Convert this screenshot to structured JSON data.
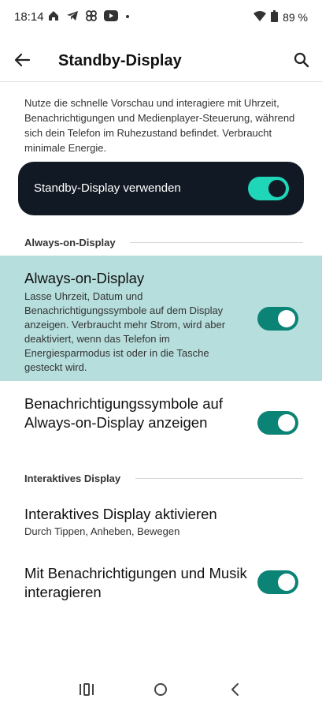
{
  "status_bar": {
    "time": "18:14",
    "battery": "89 %",
    "icons": [
      "home-icon",
      "telegram-icon",
      "chat-icon",
      "youtube-icon",
      "dot-icon",
      "wifi-icon",
      "battery-icon"
    ]
  },
  "header": {
    "title": "Standby-Display",
    "back_icon": "arrow-back-icon",
    "search_icon": "search-icon"
  },
  "description": "Nutze die schnelle Vorschau und interagiere mit Uhrzeit, Benachrichtigungen und Medienplayer-Steuerung, während sich dein Telefon im Ruhezustand befindet. Verbraucht minimale Energie.",
  "master_toggle": {
    "label": "Standby-Display verwenden",
    "on": true
  },
  "sections": {
    "always_on": "Always-on-Display",
    "interactive": "Interaktives Display"
  },
  "items": {
    "aod": {
      "title": "Always-on-Display",
      "subtitle": "Lasse Uhrzeit, Datum und Benachrichtigungssymbole auf dem Display anzeigen. Verbraucht mehr Strom, wird aber deaktiviert, wenn das Telefon im Energiesparmodus ist oder in die Tasche gesteckt wird.",
      "on": true
    },
    "notif_icons": {
      "title": "Benachrichtigungssymbole auf Always-on-Display anzeigen",
      "on": true
    },
    "interactive_enable": {
      "title": "Interaktives Display aktivieren",
      "subtitle": "Durch Tippen, Anheben, Bewegen"
    },
    "interact_notif": {
      "title": "Mit Benachrichtigungen und Musik interagieren",
      "on": true
    }
  },
  "colors": {
    "accent": "#0b8476",
    "accent_bright": "#20d6b9",
    "card_dark": "#111a24",
    "highlight": "#b6dedd"
  },
  "nav_bar": {
    "icons": [
      "recents-icon",
      "home-button-icon",
      "back-nav-icon"
    ]
  }
}
